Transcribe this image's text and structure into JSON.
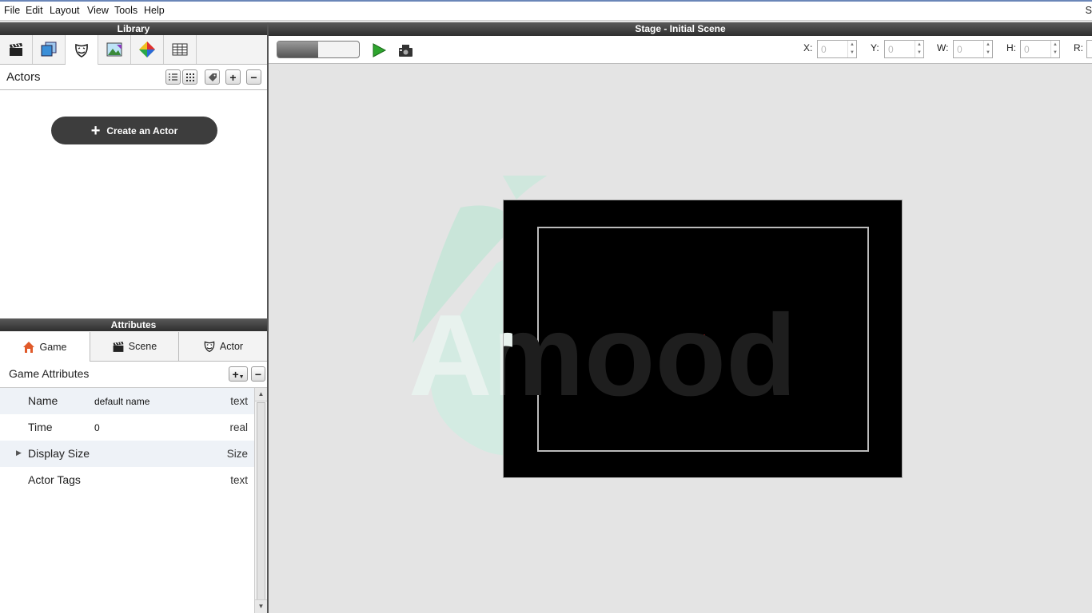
{
  "menu": [
    "File",
    "Edit",
    "Layout",
    "View",
    "Tools",
    "Help"
  ],
  "menu_cut": "S",
  "library": {
    "title": "Library",
    "tabs": [
      "clapperboard-icon",
      "layers-icon",
      "actor-mask-icon",
      "image-icon",
      "palette-icon",
      "table-icon"
    ],
    "section_title": "Actors",
    "create_button": "Create an Actor"
  },
  "attributes": {
    "title": "Attributes",
    "tabs": [
      {
        "label": "Game",
        "icon": "house-icon"
      },
      {
        "label": "Scene",
        "icon": "clapperboard-icon"
      },
      {
        "label": "Actor",
        "icon": "actor-mask-icon"
      }
    ],
    "section_title": "Game Attributes",
    "rows": [
      {
        "name": "Name",
        "value": "default name",
        "type": "text"
      },
      {
        "name": "Time",
        "value": "0",
        "type": "real"
      },
      {
        "name": "Display Size",
        "value": "",
        "type": "Size"
      },
      {
        "name": "Actor Tags",
        "value": "",
        "type": "text"
      }
    ]
  },
  "stage": {
    "title": "Stage - Initial Scene",
    "fields": [
      {
        "label": "X:",
        "value": "0"
      },
      {
        "label": "Y:",
        "value": "0"
      },
      {
        "label": "W:",
        "value": "0"
      },
      {
        "label": "H:",
        "value": "0"
      },
      {
        "label": "R:",
        "value": ""
      }
    ]
  },
  "colors": {
    "accent_play": "#2ea52e",
    "panel_header": "#3a3a3a",
    "button_dark": "#3d3d3d"
  }
}
